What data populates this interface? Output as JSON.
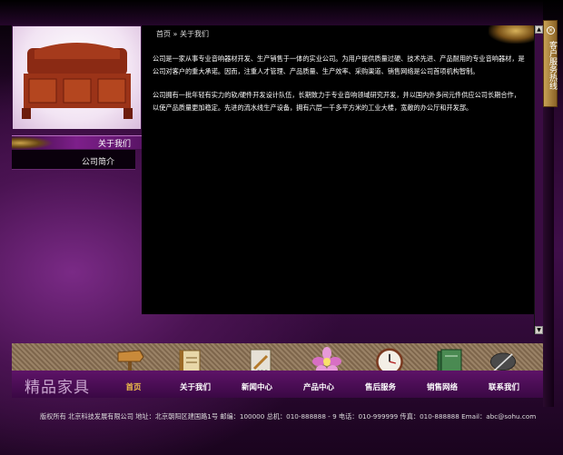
{
  "breadcrumb": "首页 » 关于我们",
  "sidebar": {
    "heading": "关于我们",
    "items": [
      {
        "label": "公司简介"
      }
    ]
  },
  "content": {
    "paragraphs": [
      "公司是一家从事专业音响器材开发、生产销售于一体的实业公司。为用户提供质量过硬、技术先进、产品耐用的专业音响器材，是公司对客户的重大承诺。因而，注重人才管理、产品质量、生产效率、采购渠道、销售网络是公司首项机构智制。",
      "公司拥有一批年轻有实力的软/硬件开发设计队伍，长期致力于专业音响领域研究开发，并以国内外多间元件供应公司长期合作，以使产品质量更加稳定。先进的流水线生产设备，拥有六层一千多平方米的工业大楼，宽敞的办公厅和开发部。"
    ]
  },
  "hotline": {
    "label": "客户服务热线"
  },
  "logo": "精品家具",
  "nav": {
    "items": [
      {
        "label": "首页",
        "icon": "signpost-icon"
      },
      {
        "label": "关于我们",
        "icon": "book-icon"
      },
      {
        "label": "新闻中心",
        "icon": "document-icon"
      },
      {
        "label": "产品中心",
        "icon": "flower-icon"
      },
      {
        "label": "售后服务",
        "icon": "clock-icon"
      },
      {
        "label": "销售网络",
        "icon": "folder-icon"
      },
      {
        "label": "联系我们",
        "icon": "pen-icon"
      }
    ]
  },
  "footer": "版权所有  北京科技发展有限公司 地址：北京朝阳区建国路1号 邮编：100000   总机：010-888888 - 9 电话：010-999999 传真：010-888888 Email：abc@sohu.com"
}
